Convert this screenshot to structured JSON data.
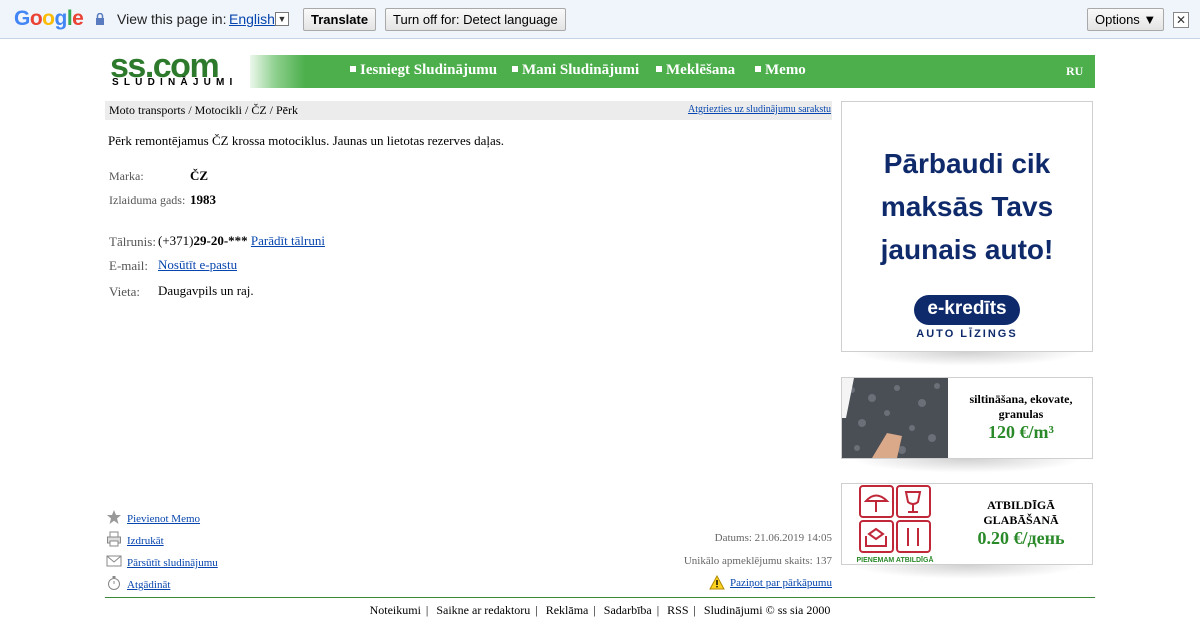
{
  "translate_bar": {
    "logo_letters": [
      {
        "ch": "G",
        "color": "#4285f4"
      },
      {
        "ch": "o",
        "color": "#ea4335"
      },
      {
        "ch": "o",
        "color": "#fbbc05"
      },
      {
        "ch": "g",
        "color": "#4285f4"
      },
      {
        "ch": "l",
        "color": "#34a853"
      },
      {
        "ch": "e",
        "color": "#ea4335"
      }
    ],
    "view_text": "View this page in:",
    "language": "English",
    "translate_label": "Translate",
    "turn_off_label": "Turn off for: Detect language",
    "options_label": "Options ▼",
    "close_label": "✕"
  },
  "header": {
    "logo_main": "ss.com",
    "logo_sub": "SLUDINĀJUMI",
    "nav": [
      "Iesniegt Sludinājumu",
      "Mani Sludinājumi",
      "Meklēšana",
      "Memo"
    ],
    "lang": "RU"
  },
  "breadcrumb": {
    "path": "Moto transports / Motocikli / ČZ / Pērk",
    "back_link": "Atgriezties uz sludinājumu sarakstu"
  },
  "listing": {
    "description": "Pērk remontējamus ČZ krossa motociklus. Jaunas un lietotas rezerves daļas.",
    "brand_label": "Marka:",
    "brand_value": "ČZ",
    "year_label": "Izlaiduma gads:",
    "year_value": "1983",
    "phone_label": "Tālrunis:",
    "phone_prefix": "(+371)",
    "phone_value": "29-20-***",
    "phone_show": "Parādīt tālruni",
    "email_label": "E-mail:",
    "email_link": "Nosūtīt e-pastu",
    "place_label": "Vieta:",
    "place_value": "Daugavpils un raj."
  },
  "actions": {
    "memo": "Pievienot Memo",
    "print": "Izdrukāt",
    "forward": "Pārsūtīt sludinājumu",
    "remind": "Atgādināt"
  },
  "meta": {
    "date": "Datums: 21.06.2019 14:05",
    "views": "Unikālo apmeklējumu skaits: 137",
    "report": "Paziņot par pārkāpumu"
  },
  "footer": {
    "links": [
      "Noteikumi",
      "Saikne ar redaktoru",
      "Reklāma",
      "Sadarbība",
      "RSS"
    ],
    "copyright": "Sludinājumi © ss sia 2000"
  },
  "ads": {
    "ad1_lines": [
      "Pārbaudi cik",
      "maksās Tavs",
      "jaunais auto!"
    ],
    "ad1_brand": "e-kredīts",
    "ad1_sub": "AUTO LĪZINGS",
    "ad2_caption": "siltināšana, ekovate, granulas",
    "ad2_price": "120 €/m³",
    "ad3_caption": "ATBILDĪGĀ GLABĀŠANĀ",
    "ad3_price": "0.20 €/день",
    "ad3_img_text": "PIENEMAM ATBILDĪGĀ"
  },
  "colors": {
    "nav_green": "#4caf4c",
    "logo_green": "#2d7a2d",
    "price_green": "#2a8a2a",
    "ad_navy": "#0f2a6b"
  }
}
